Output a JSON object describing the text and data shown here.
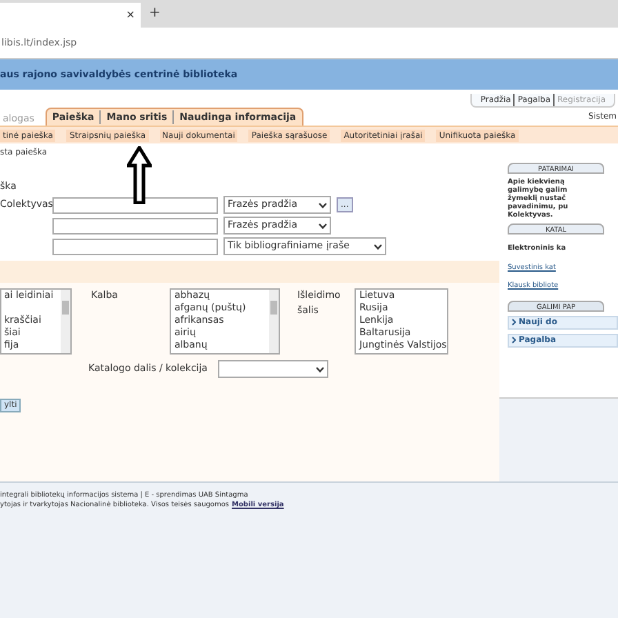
{
  "browser": {
    "tab_close": "×",
    "new_tab": "+",
    "address": "libis.lt/index.jsp"
  },
  "header": {
    "title": "aus rajono savivaldybės centrinė biblioteka"
  },
  "top_links": [
    "Pradžia",
    "Pagalba",
    "Registracija"
  ],
  "main_tabs": [
    {
      "label": "alogas",
      "selected": false
    },
    {
      "label": "Paieška",
      "selected": true
    },
    {
      "label": "Mano sritis",
      "selected": true
    },
    {
      "label": "Naudinga informacija",
      "selected": true
    }
  ],
  "system_label": "Sistem",
  "sub_tabs": [
    "tinė paieška",
    "Straipsnių paieška",
    "Nauji dokumentai",
    "Paieška sąrašuose",
    "Autoritetiniai įrašai",
    "Unifikuota paieška"
  ],
  "sub_sub": "sta paieška",
  "section_title": "ška",
  "fields": [
    {
      "label": "Colektyvas",
      "mode": "Frazės pradžia",
      "browse": "..."
    },
    {
      "mode": "Frazės pradžia"
    },
    {
      "mode": "Tik bibliografiniame įraše"
    }
  ],
  "type_list": [
    "ai leidiniai",
    "kraščiai",
    "šiai",
    "fija"
  ],
  "language": {
    "label": "Kalba",
    "items": [
      "abhazų",
      "afganų (puštų)",
      "afrikansas",
      "airių",
      "albanų"
    ]
  },
  "country": {
    "label": "Išleidimo šalis",
    "items": [
      "Lietuva",
      "Rusija",
      "Lenkija",
      "Baltarusija",
      "Jungtinės Valstijos"
    ]
  },
  "collection": {
    "label": "Katalogo dalis / kolekcija"
  },
  "submit": "ylti",
  "sidebar": {
    "tips_tab": "PATARIMAI",
    "tips_text": [
      "Apie kiekvieną",
      "galimybę galim",
      "žymeklį nustač",
      "pavadinimu, pu",
      "Kolektyvas."
    ],
    "catalog_tab": "KATAL",
    "catalog_title": "Elektroninis ka",
    "links": [
      "Suvestinis kat",
      "Klausk bibliote"
    ],
    "options_tab": "GALIMI PAP",
    "options": [
      "Nauji do",
      "Pagalba"
    ]
  },
  "footer": {
    "line1": "integrali bibliotekų informacijos sistema | E - sprendimas UAB Sintagma",
    "line2": "ytojas ir tvarkytojas Nacionalinė biblioteka. Visos teisės saugomos",
    "mobile_link": "Mobili versija"
  }
}
